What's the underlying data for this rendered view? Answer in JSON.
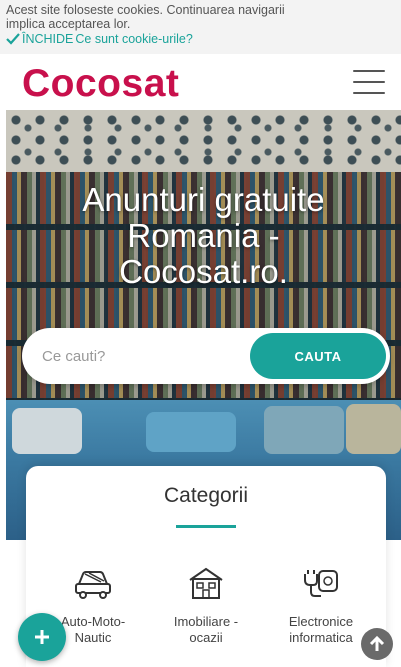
{
  "cookie": {
    "message_line1": "Acest site foloseste cookies. Continuarea navigarii",
    "message_line2": "implica acceptarea lor.",
    "close_label": "ÎNCHIDE",
    "info_link": "Ce sunt cookie-urile?"
  },
  "header": {
    "logo": "Cocosat",
    "menu_icon": "hamburger-menu-icon"
  },
  "hero": {
    "title_line1": "Anunturi gratuite",
    "title_line2": "Romania -",
    "title_line3": "Cocosat.ro."
  },
  "search": {
    "placeholder": "Ce cauti?",
    "button_label": "CAUTA"
  },
  "categories": {
    "title": "Categorii",
    "items": [
      {
        "line1": "Auto-Moto-",
        "line2": "Nautic",
        "icon": "car-icon"
      },
      {
        "line1": "Imobiliare -",
        "line2": "ocazii",
        "icon": "house-icon"
      },
      {
        "line1": "Electronice",
        "line2": "informatica",
        "icon": "plug-socket-icon"
      }
    ]
  },
  "fab": {
    "icon": "plus-icon"
  },
  "scroll_top": {
    "icon": "arrow-up-icon"
  },
  "colors": {
    "brand": "#c8104c",
    "accent": "#1aa39a"
  }
}
